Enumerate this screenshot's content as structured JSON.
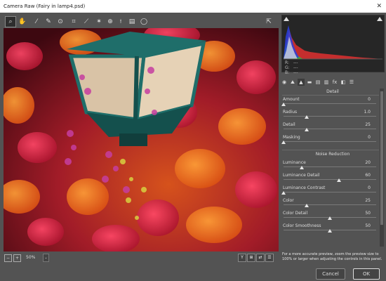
{
  "window": {
    "title": "Camera Raw (Fairy in lamp4.psd)",
    "close_glyph": "✕"
  },
  "toolbar": {
    "tools": [
      {
        "name": "zoom-tool",
        "glyph": "⌕",
        "active": true
      },
      {
        "name": "hand-tool",
        "glyph": "✋"
      },
      {
        "name": "white-balance-tool",
        "glyph": "⁄"
      },
      {
        "name": "color-sampler-tool",
        "glyph": "✎"
      },
      {
        "name": "targeted-adjustment-tool",
        "glyph": "⊙"
      },
      {
        "name": "crop-tool",
        "glyph": "⌗"
      },
      {
        "name": "straighten-tool",
        "glyph": "⟋"
      },
      {
        "name": "spot-removal-tool",
        "glyph": "✶"
      },
      {
        "name": "red-eye-tool",
        "glyph": "⊕"
      },
      {
        "name": "adjustment-brush-tool",
        "glyph": "⟊"
      },
      {
        "name": "graduated-filter-tool",
        "glyph": "▤"
      },
      {
        "name": "radial-filter-tool",
        "glyph": "◯"
      }
    ],
    "export_glyph": "⇱"
  },
  "status": {
    "zoom": "50%",
    "zoom_minus": "−",
    "zoom_plus": "+",
    "dropdown_glyph": "⌄",
    "view_buttons": [
      "Y",
      "⊞",
      "⇄",
      "☰"
    ]
  },
  "histogram": {
    "r_label": "R:",
    "g_label": "G:",
    "b_label": "B:",
    "r_value": "---",
    "g_value": "---",
    "b_value": "---"
  },
  "panel_tabs": [
    "◉",
    "⛰",
    "▲",
    "▬",
    "▤",
    "▥",
    "fx",
    "◧",
    "☰"
  ],
  "detail": {
    "title": "Detail",
    "sharpening": [
      {
        "label": "Amount",
        "value": "0",
        "position": 0
      },
      {
        "label": "Radius",
        "value": "1.0",
        "position": 0.25
      },
      {
        "label": "Detail",
        "value": "25",
        "position": 0.25
      },
      {
        "label": "Masking",
        "value": "0",
        "position": 0
      }
    ],
    "noise_title": "Noise Reduction",
    "noise": [
      {
        "label": "Luminance",
        "value": "20",
        "position": 0.2
      },
      {
        "label": "Luminance Detail",
        "value": "60",
        "position": 0.6
      },
      {
        "label": "Luminance Contrast",
        "value": "0",
        "position": 0
      },
      {
        "label": "Color",
        "value": "25",
        "position": 0.25
      },
      {
        "label": "Color Detail",
        "value": "50",
        "position": 0.5
      },
      {
        "label": "Color Smoothness",
        "value": "50",
        "position": 0.5
      }
    ],
    "note": "For a more accurate preview, zoom the preview size to 100% or larger when adjusting the controls in this panel."
  },
  "buttons": {
    "cancel": "Cancel",
    "ok": "OK"
  }
}
